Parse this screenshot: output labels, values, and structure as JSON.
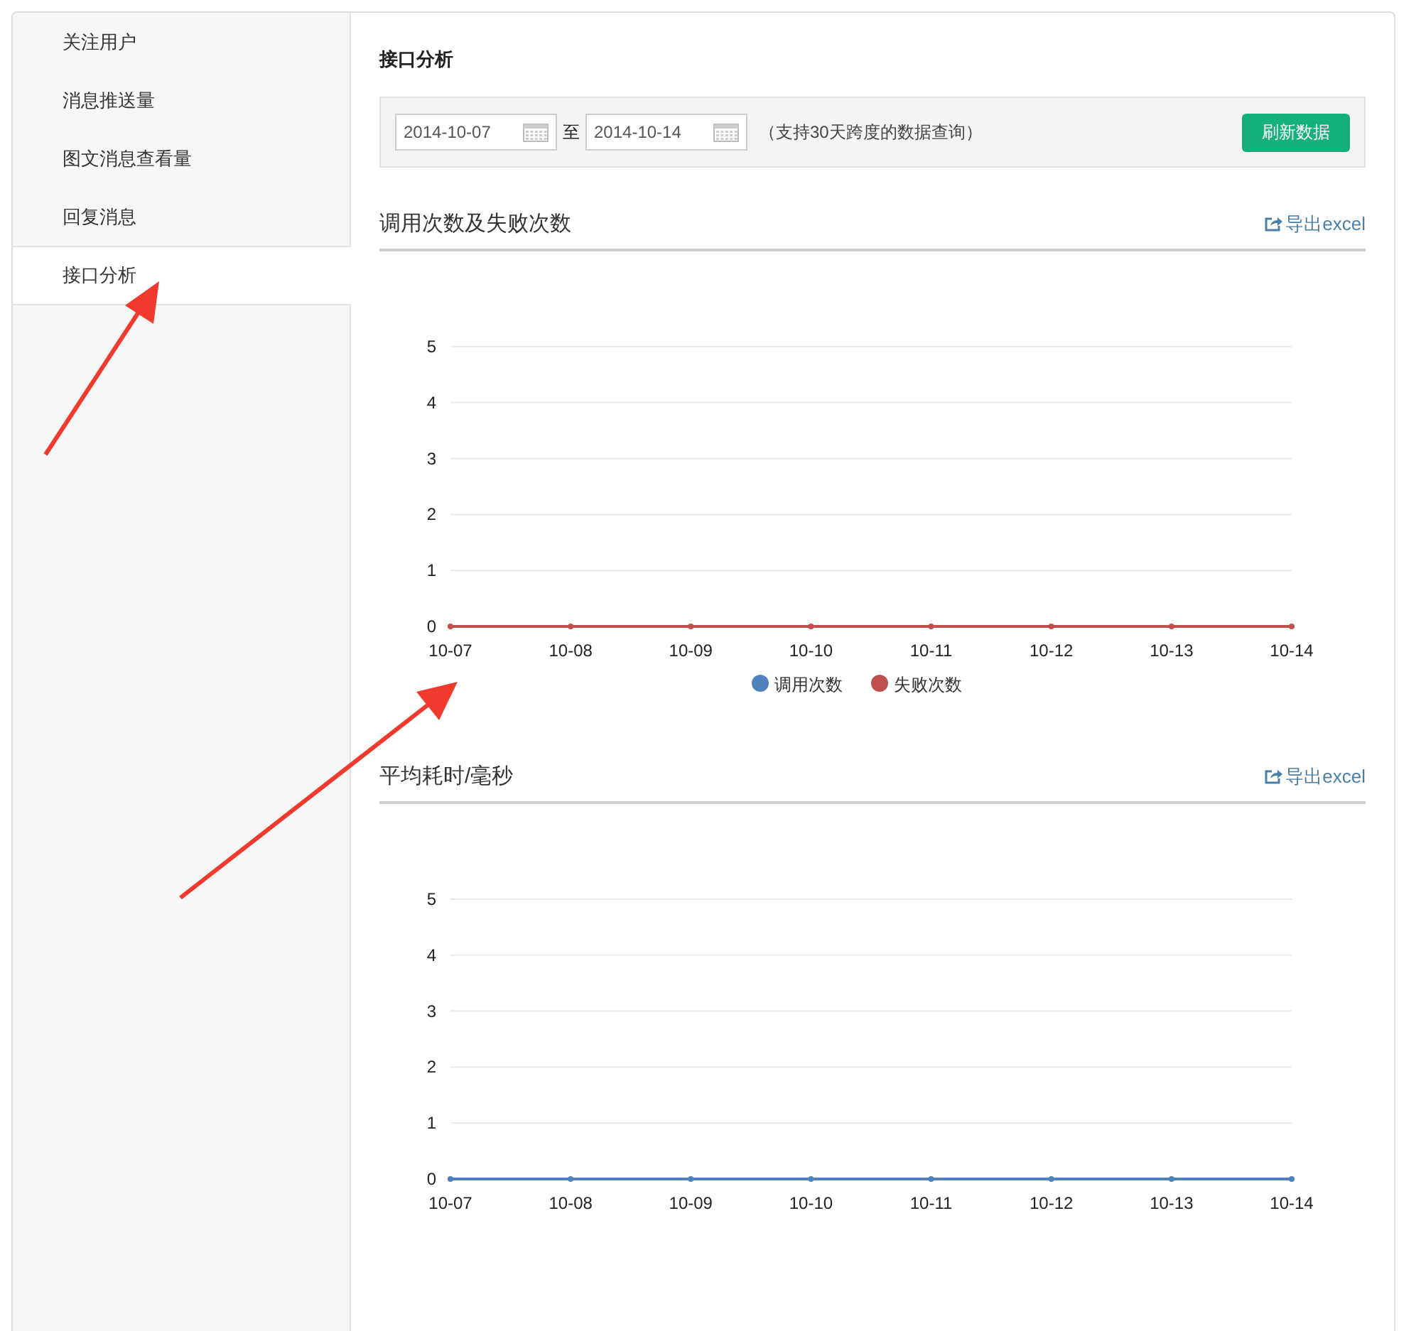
{
  "sidebar": {
    "items": [
      {
        "label": "关注用户",
        "selected": false
      },
      {
        "label": "消息推送量",
        "selected": false
      },
      {
        "label": "图文消息查看量",
        "selected": false
      },
      {
        "label": "回复消息",
        "selected": false
      },
      {
        "label": "接口分析",
        "selected": true
      }
    ]
  },
  "page_title": "接口分析",
  "date_filter": {
    "start": "2014-10-07",
    "separator": "至",
    "end": "2014-10-14",
    "hint": "（支持30天跨度的数据查询）",
    "refresh_button": "刷新数据"
  },
  "sections": [
    {
      "title": "调用次数及失败次数",
      "export_link": "导出excel",
      "chart_data": {
        "type": "line",
        "grid": true,
        "legend": "bottom",
        "categories": [
          "10-07",
          "10-08",
          "10-09",
          "10-10",
          "10-11",
          "10-12",
          "10-13",
          "10-14"
        ],
        "ylim": [
          0,
          5
        ],
        "yticks": [
          0,
          1,
          2,
          3,
          4,
          5
        ],
        "series": [
          {
            "name": "调用次数",
            "color": "#4f81bd",
            "marker": "circle",
            "values": [
              null,
              null,
              null,
              null,
              null,
              null,
              null,
              null
            ]
          },
          {
            "name": "失败次数",
            "color": "#c0504d",
            "marker": "circle",
            "values": [
              0,
              0,
              0,
              0,
              0,
              0,
              0,
              0
            ]
          }
        ]
      }
    },
    {
      "title": "平均耗时/毫秒",
      "export_link": "导出excel",
      "chart_data": {
        "type": "line",
        "grid": true,
        "categories": [
          "10-07",
          "10-08",
          "10-09",
          "10-10",
          "10-11",
          "10-12",
          "10-13",
          "10-14"
        ],
        "ylim": [
          0,
          5
        ],
        "yticks": [
          0,
          1,
          2,
          3,
          4,
          5
        ],
        "series": [
          {
            "color": "#4f81bd",
            "marker": "circle",
            "values": [
              0,
              0,
              0,
              0,
              0,
              0,
              0,
              0
            ]
          }
        ]
      }
    }
  ]
}
